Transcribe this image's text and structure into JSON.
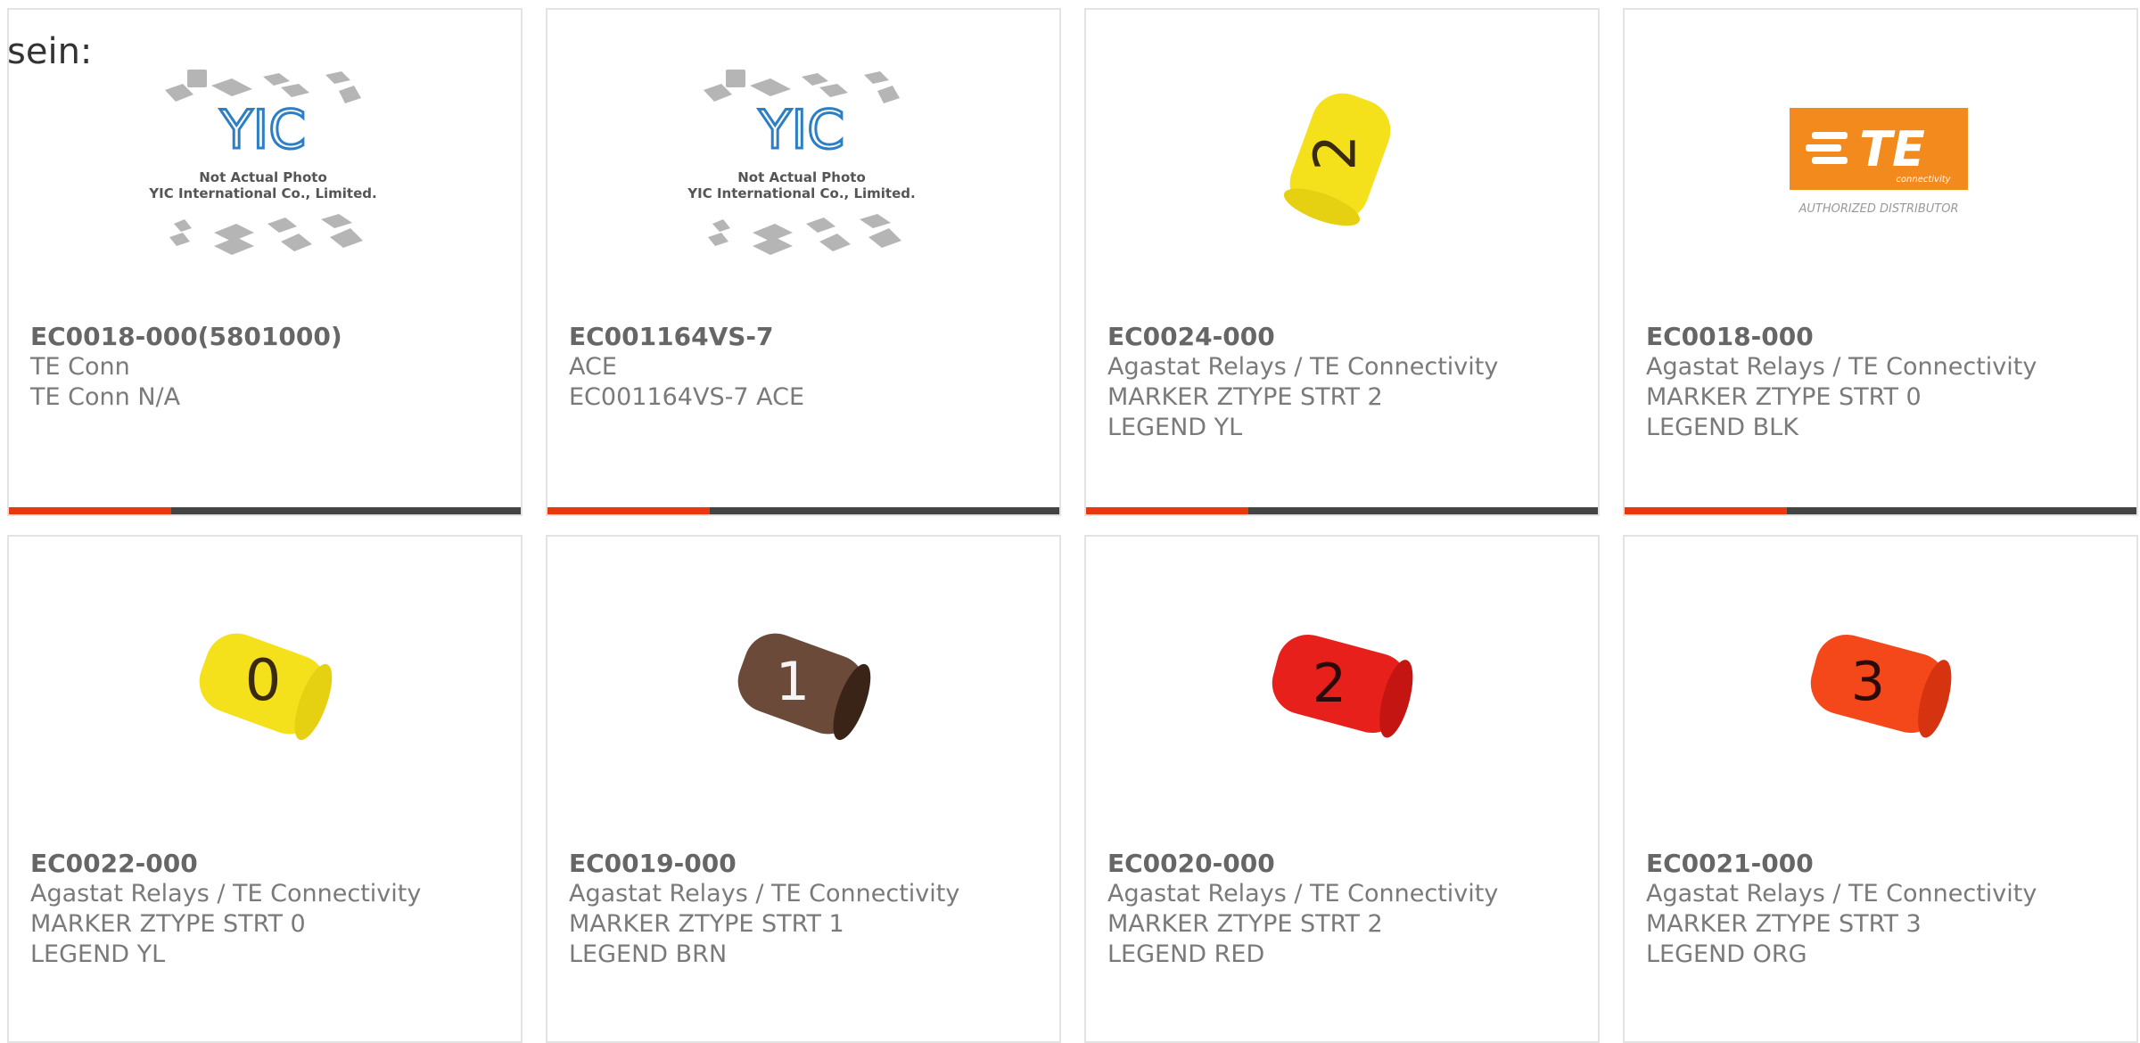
{
  "intro_text": "sein:",
  "products": [
    {
      "part_number": "EC0018-000(5801000)",
      "manufacturer": "TE Conn",
      "description": "TE Conn N/A",
      "image": "yic-placeholder-icon",
      "image_text": {
        "line1": "Not Actual Photo",
        "line2": "YIC International Co., Limited."
      }
    },
    {
      "part_number": "EC001164VS-7",
      "manufacturer": "ACE",
      "description": "EC001164VS-7 ACE",
      "image": "yic-placeholder-icon",
      "image_text": {
        "line1": "Not Actual Photo",
        "line2": "YIC International Co., Limited."
      }
    },
    {
      "part_number": "EC0024-000",
      "manufacturer": "Agastat Relays / TE Connectivity",
      "description": "MARKER ZTYPE STRT 2 LEGEND YL",
      "image": "yellow-marker-2-icon",
      "marker_color": "#f4e11c",
      "legend": "2"
    },
    {
      "part_number": "EC0018-000",
      "manufacturer": "Agastat Relays / TE Connectivity",
      "description": "MARKER ZTYPE STRT 0 LEGEND BLK",
      "image": "te-logo-icon",
      "image_text": {
        "logo": "TE",
        "tagline": "connectivity",
        "caption": "AUTHORIZED DISTRIBUTOR"
      },
      "logo_color": "#f28a1e"
    },
    {
      "part_number": "EC0022-000",
      "manufacturer": "Agastat Relays / TE Connectivity",
      "description": "MARKER ZTYPE STRT 0 LEGEND YL",
      "image": "yellow-marker-0-icon",
      "marker_color": "#f4e11c",
      "legend": "0"
    },
    {
      "part_number": "EC0019-000",
      "manufacturer": "Agastat Relays / TE Connectivity",
      "description": "MARKER ZTYPE STRT 1 LEGEND BRN",
      "image": "brown-marker-1-icon",
      "marker_color": "#6b4a3a",
      "legend": "1"
    },
    {
      "part_number": "EC0020-000",
      "manufacturer": "Agastat Relays / TE Connectivity",
      "description": "MARKER ZTYPE STRT 2 LEGEND RED",
      "image": "red-marker-2-icon",
      "marker_color": "#e8201c",
      "legend": "2"
    },
    {
      "part_number": "EC0021-000",
      "manufacturer": "Agastat Relays / TE Connectivity",
      "description": "MARKER ZTYPE STRT 3 LEGEND ORG",
      "image": "orange-marker-3-icon",
      "marker_color": "#f4471a",
      "legend": "3"
    }
  ],
  "colors": {
    "accent": "#e8380d",
    "bar": "#444444",
    "border": "#e3e3e3"
  }
}
